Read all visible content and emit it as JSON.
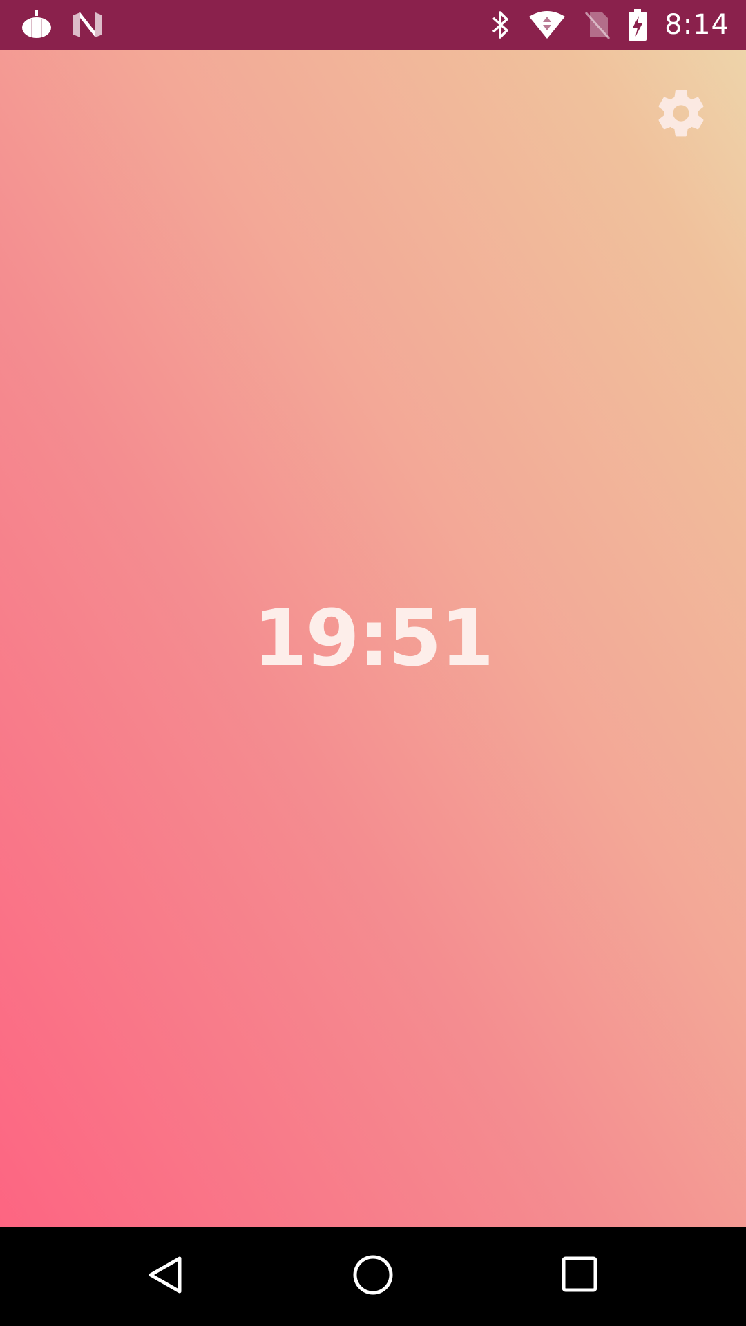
{
  "status_bar": {
    "time": "8:14",
    "background_color": "#8a214c",
    "icons_left": [
      "pumpkin-icon",
      "n-logo-icon"
    ],
    "icons_right": [
      "bluetooth-icon",
      "wifi-icon",
      "no-sim-icon",
      "battery-charging-icon"
    ]
  },
  "main": {
    "clock_time": "19:51",
    "settings_icon": "gear-icon",
    "gradient_colors": [
      "#fd6582",
      "#f48d90",
      "#f3a897",
      "#f0c19c",
      "#eed4aa"
    ],
    "clock_color": "#fdeeea"
  },
  "nav_bar": {
    "buttons": [
      "back-icon",
      "home-icon",
      "recents-icon"
    ]
  }
}
